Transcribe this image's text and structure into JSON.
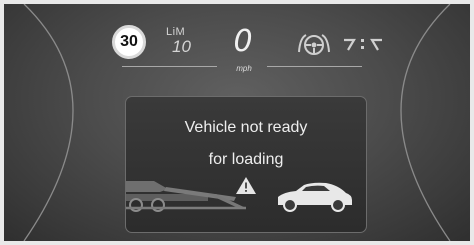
{
  "speed_limit_sign": "30",
  "limit_label": "LiM",
  "limit_value": "10",
  "speed_value": "0",
  "speed_unit": "mph",
  "message_line1": "Vehicle not ready",
  "message_line2": "for loading",
  "icons": [
    "speed-limit-sign-icon",
    "steering-wheel-assist-icon",
    "lane-keeping-icon",
    "warning-triangle-icon",
    "tow-truck-icon",
    "car-icon"
  ]
}
